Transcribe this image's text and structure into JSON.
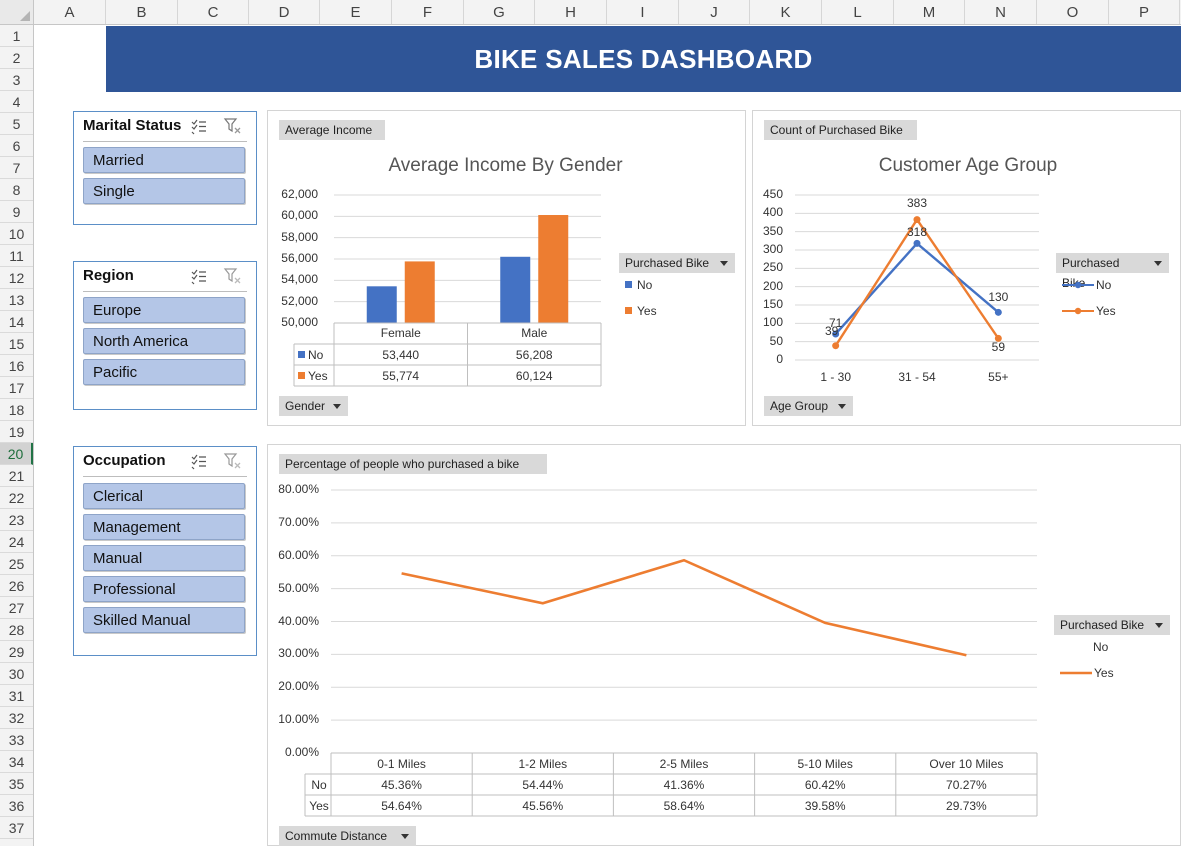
{
  "sheet": {
    "columns": [
      "A",
      "B",
      "C",
      "D",
      "E",
      "F",
      "G",
      "H",
      "I",
      "J",
      "K",
      "L",
      "M",
      "N",
      "O",
      "P"
    ],
    "rows": [
      "1",
      "2",
      "3",
      "4",
      "5",
      "6",
      "7",
      "8",
      "9",
      "10",
      "11",
      "12",
      "13",
      "14",
      "15",
      "16",
      "17",
      "18",
      "19",
      "20",
      "21",
      "22",
      "23",
      "24",
      "25",
      "26",
      "27",
      "28",
      "29",
      "30",
      "31",
      "32",
      "33",
      "34",
      "35",
      "36",
      "37"
    ],
    "selected_row": "20"
  },
  "banner": {
    "title": "BIKE SALES DASHBOARD"
  },
  "slicers": {
    "marital": {
      "title": "Marital Status",
      "items": [
        "Married",
        "Single"
      ]
    },
    "region": {
      "title": "Region",
      "items": [
        "Europe",
        "North America",
        "Pacific"
      ]
    },
    "occupation": {
      "title": "Occupation",
      "items": [
        "Clerical",
        "Management",
        "Manual",
        "Professional",
        "Skilled Manual"
      ]
    }
  },
  "colors": {
    "no": "#4472c4",
    "yes": "#ed7d31",
    "banner": "#2f5597",
    "slicer_item": "#b4c6e7"
  },
  "income_panel": {
    "value_field": "Average Income",
    "axis_field": "Gender",
    "legend_field": "Purchased Bike",
    "legend": [
      "No",
      "Yes"
    ],
    "table_rows": [
      "No",
      "Yes"
    ],
    "table_cells": [
      [
        "53,440",
        "56,208"
      ],
      [
        "55,774",
        "60,124"
      ]
    ]
  },
  "age_panel": {
    "value_field": "Count of Purchased Bike",
    "axis_field": "Age Group",
    "legend_field": "Purchased Bike",
    "legend": [
      "No",
      "Yes"
    ]
  },
  "commute_panel": {
    "value_field": "Percentage of people who purchased a bike",
    "axis_field": "Commute Distance",
    "legend_field": "Purchased Bike",
    "legend": [
      "No",
      "Yes"
    ],
    "table_rows": [
      "No",
      "Yes"
    ],
    "table_cells": [
      [
        "45.36%",
        "54.44%",
        "41.36%",
        "60.42%",
        "70.27%"
      ],
      [
        "54.64%",
        "45.56%",
        "58.64%",
        "39.58%",
        "29.73%"
      ]
    ]
  },
  "chart_data": [
    {
      "type": "bar",
      "title": "Average Income By Gender",
      "categories": [
        "Female",
        "Male"
      ],
      "series": [
        {
          "name": "No",
          "values": [
            53440,
            56208
          ]
        },
        {
          "name": "Yes",
          "values": [
            55774,
            60124
          ]
        }
      ],
      "ylim": [
        50000,
        62000
      ],
      "yticks": [
        "62,000",
        "60,000",
        "58,000",
        "56,000",
        "54,000",
        "52,000",
        "50,000"
      ],
      "grid": true,
      "legend_position": "right"
    },
    {
      "type": "line",
      "title": "Customer Age Group",
      "categories": [
        "1 - 30",
        "31 - 54",
        "55+"
      ],
      "series": [
        {
          "name": "No",
          "values": [
            71,
            318,
            130
          ]
        },
        {
          "name": "Yes",
          "values": [
            39,
            383,
            59
          ]
        }
      ],
      "ylim": [
        0,
        450
      ],
      "yticks": [
        "450",
        "400",
        "350",
        "300",
        "250",
        "200",
        "150",
        "100",
        "50",
        "0"
      ],
      "grid": true,
      "markers": true,
      "legend_position": "right"
    },
    {
      "type": "line",
      "title": "",
      "categories": [
        "0-1 Miles",
        "1-2 Miles",
        "2-5 Miles",
        "5-10 Miles",
        "Over 10 Miles"
      ],
      "series": [
        {
          "name": "No",
          "values": [
            45.36,
            54.44,
            41.36,
            60.42,
            70.27
          ],
          "visible": false
        },
        {
          "name": "Yes",
          "values": [
            54.64,
            45.56,
            58.64,
            39.58,
            29.73
          ]
        }
      ],
      "ylim": [
        0,
        80
      ],
      "yticks": [
        "80.00%",
        "70.00%",
        "60.00%",
        "50.00%",
        "40.00%",
        "30.00%",
        "20.00%",
        "10.00%",
        "0.00%"
      ],
      "grid": true,
      "legend_position": "right"
    }
  ]
}
